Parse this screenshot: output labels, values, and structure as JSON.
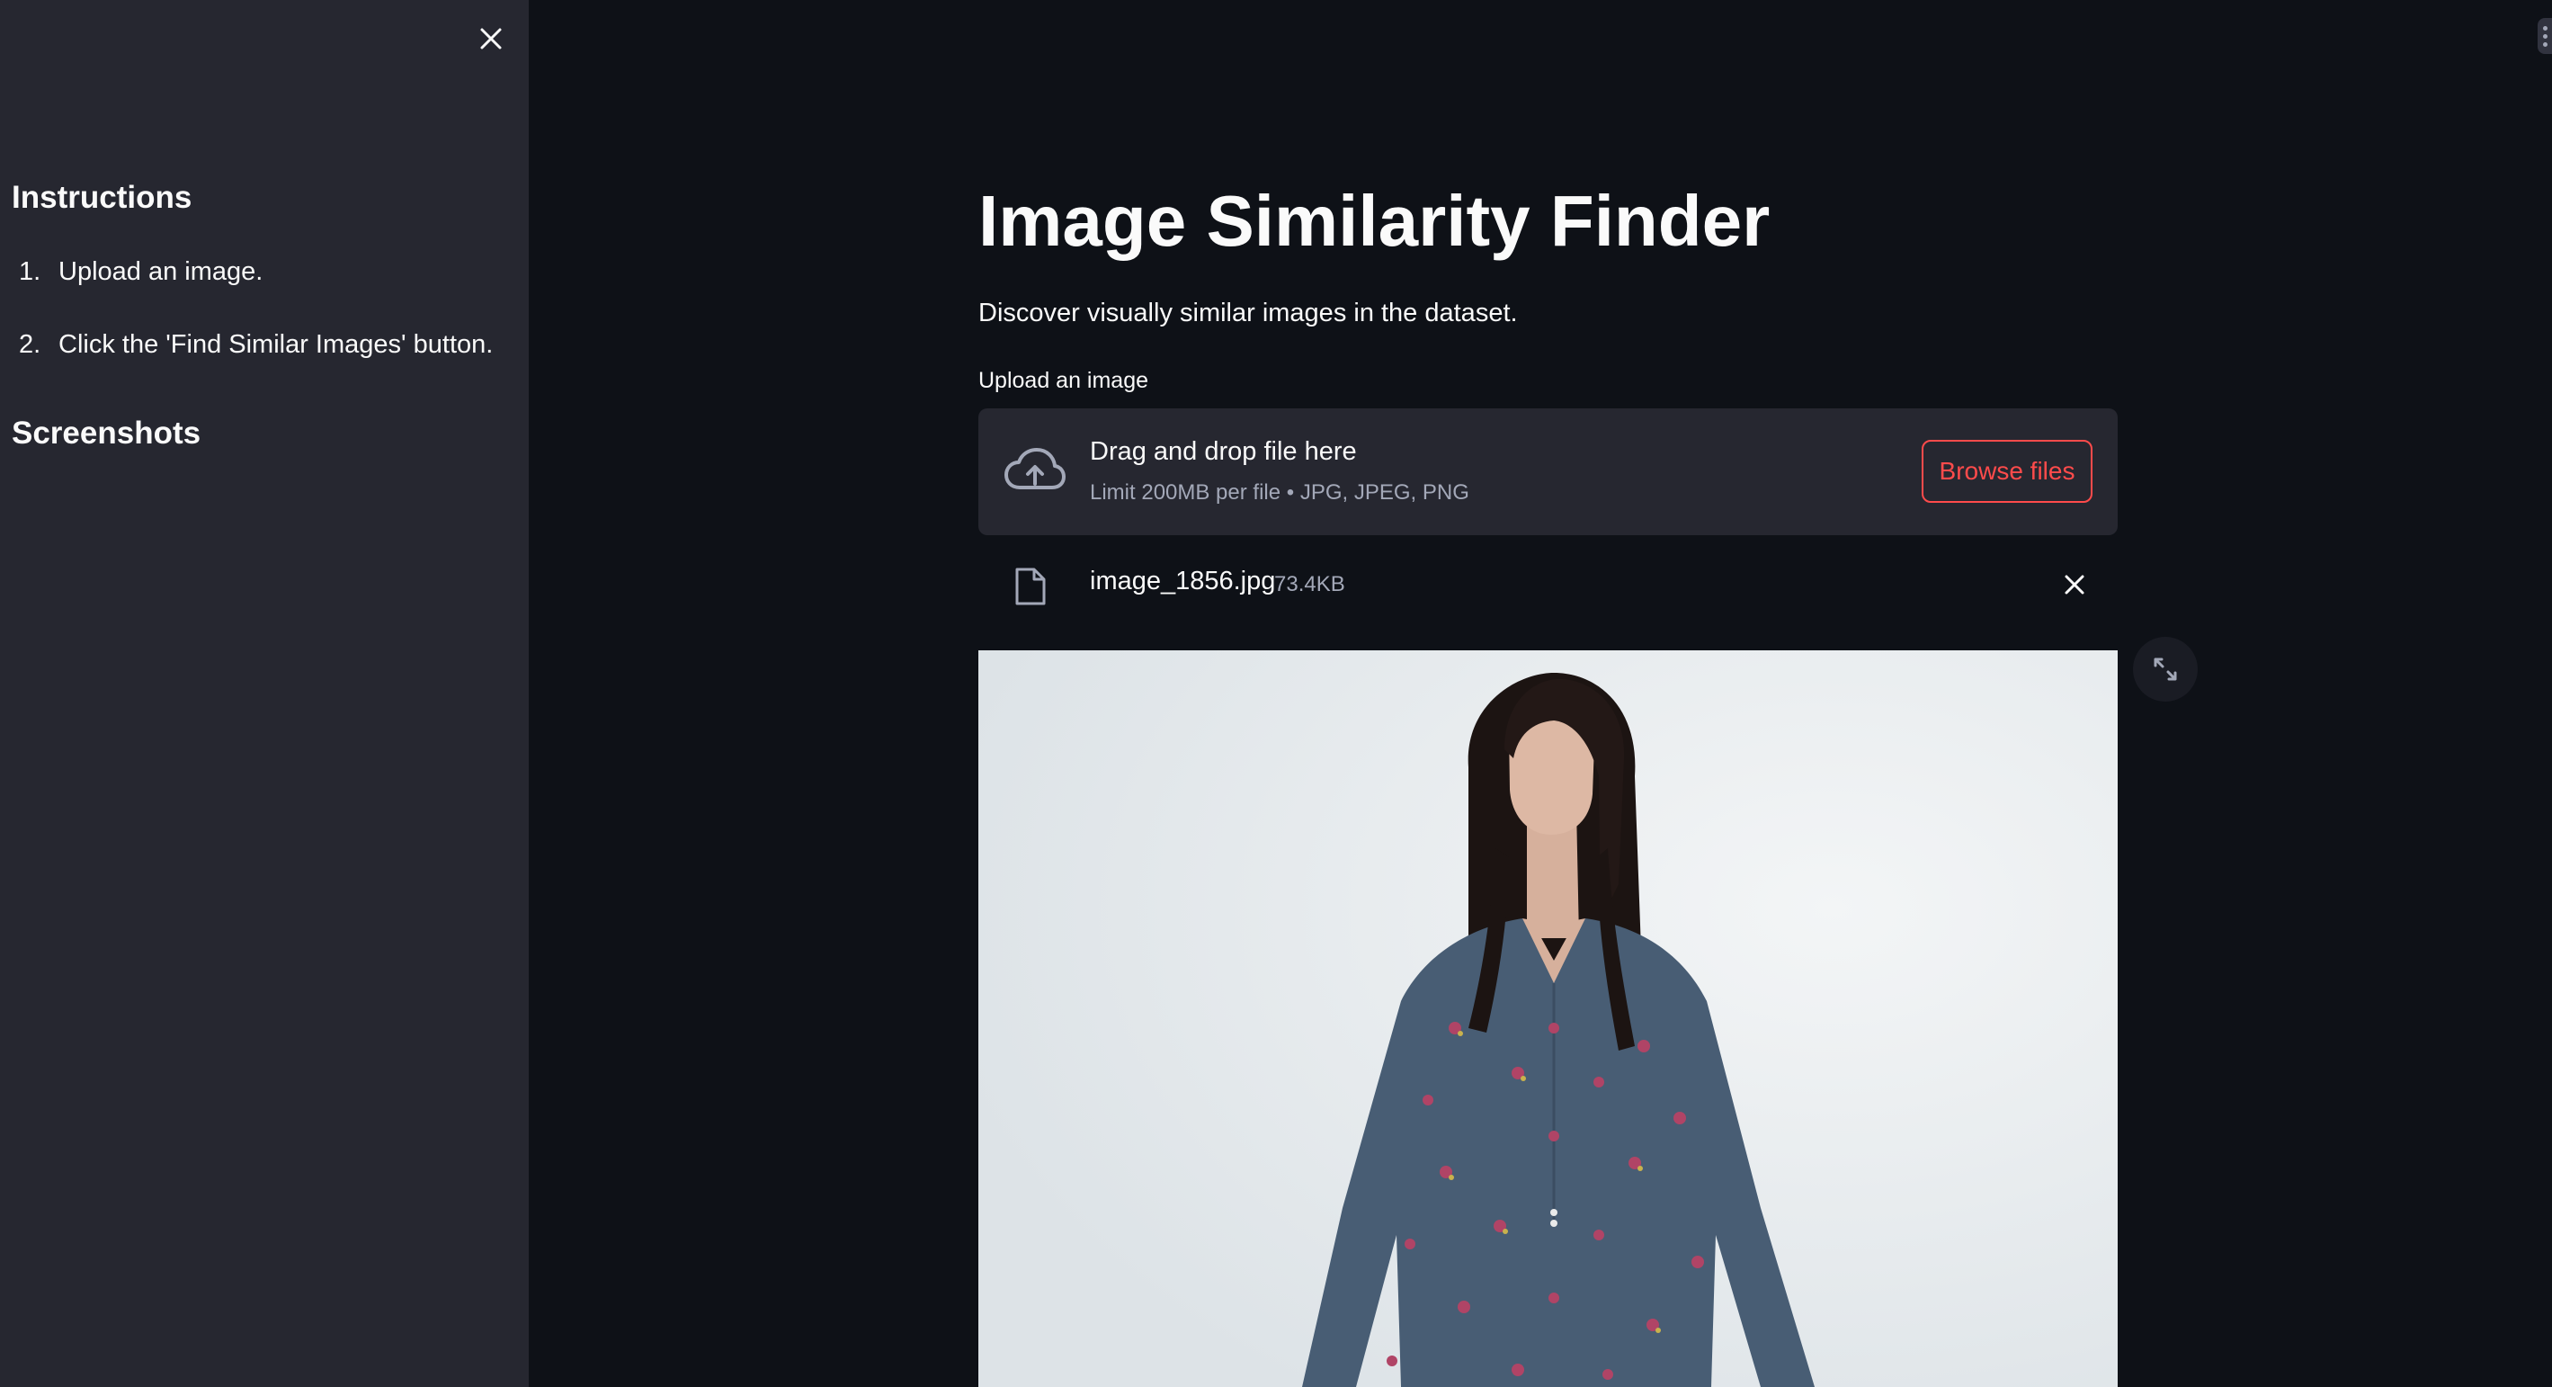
{
  "sidebar": {
    "instructions_heading": "Instructions",
    "steps": [
      {
        "num": "1.",
        "text": "Upload an image."
      },
      {
        "num": "2.",
        "text": "Click the 'Find Similar Images' button."
      }
    ],
    "screenshots_heading": "Screenshots"
  },
  "main": {
    "title": "Image Similarity Finder",
    "subtitle": "Discover visually similar images in the dataset.",
    "uploader": {
      "label": "Upload an image",
      "drop_title": "Drag and drop file here",
      "drop_limit": "Limit 200MB per file • JPG, JPEG, PNG",
      "browse_label": "Browse files"
    },
    "file": {
      "name": "image_1856.jpg",
      "size": "73.4KB"
    }
  },
  "colors": {
    "app_background": "#0e1117",
    "sidebar_background": "#262730",
    "accent": "#ff4b4b",
    "muted_text": "#a3a8b8"
  },
  "icons": [
    "close-icon",
    "cloud-upload-icon",
    "file-icon",
    "remove-file-icon",
    "fullscreen-icon",
    "menu-icon"
  ]
}
